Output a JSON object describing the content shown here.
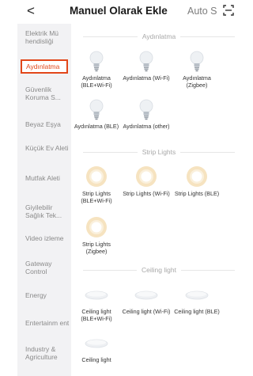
{
  "header": {
    "back_glyph": "<",
    "title": "Manuel Olarak Ekle",
    "auto_label": "Auto S",
    "scan_icon": "scan-icon"
  },
  "sidebar": {
    "items": [
      {
        "label": "Elektrik Mü hendisliği",
        "active": false
      },
      {
        "label": "Aydınlatma",
        "active": true
      },
      {
        "label": "Güvenlik Koruma S...",
        "active": false
      },
      {
        "label": "Beyaz Eşya",
        "active": false
      },
      {
        "label": "Küçük Ev Aleti",
        "active": false
      },
      {
        "label": "Mutfak Aleti",
        "active": false
      },
      {
        "label": "Giyilebilir Sağlık Tek...",
        "active": false
      },
      {
        "label": "Video izleme",
        "active": false
      },
      {
        "label": "Gateway Control",
        "active": false
      },
      {
        "label": "Energy",
        "active": false
      },
      {
        "label": "Entertainm ent",
        "active": false
      },
      {
        "label": "Industry & Agriculture",
        "active": false
      }
    ]
  },
  "sections": [
    {
      "title": "Aydınlatma",
      "icon": "bulb-icon",
      "devices": [
        {
          "label": "Aydınlatma (BLE+Wi-Fi)"
        },
        {
          "label": "Aydınlatma (Wi-Fi)"
        },
        {
          "label": "Aydınlatma (Zigbee)"
        },
        {
          "label": "Aydınlatma (BLE)"
        },
        {
          "label": "Aydınlatma (other)"
        }
      ]
    },
    {
      "title": "Strip Lights",
      "icon": "strip-light-icon",
      "devices": [
        {
          "label": "Strip Lights (BLE+Wi-Fi)"
        },
        {
          "label": "Strip Lights (Wi-Fi)"
        },
        {
          "label": "Strip Lights (BLE)"
        },
        {
          "label": "Strip Lights (Zigbee)"
        }
      ]
    },
    {
      "title": "Ceiling light",
      "icon": "ceiling-light-icon",
      "devices": [
        {
          "label": "Ceiling light (BLE+Wi-Fi)"
        },
        {
          "label": "Ceiling light (Wi-Fi)"
        },
        {
          "label": "Ceiling light (BLE)"
        },
        {
          "label": "Ceiling light"
        }
      ]
    }
  ],
  "colors": {
    "accent": "#e2471a",
    "sidebar_bg": "#f2f2f4",
    "strip_light_glow": "#f6e3c0"
  }
}
